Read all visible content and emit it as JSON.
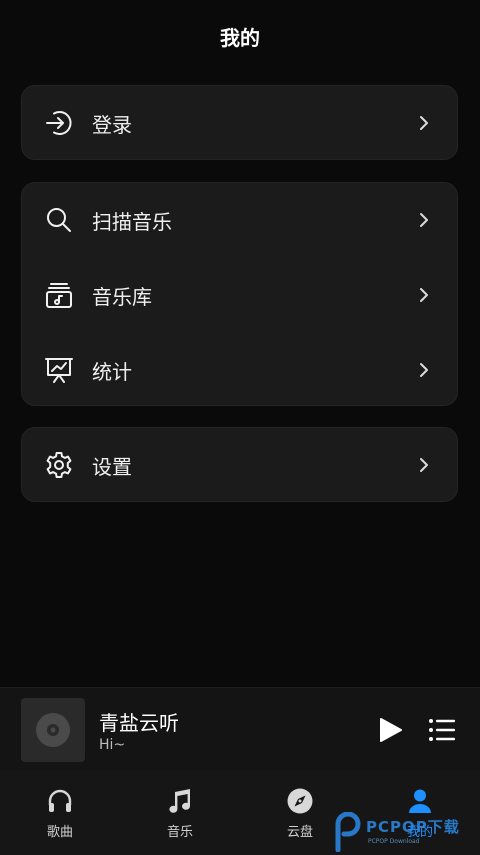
{
  "header": {
    "title": "我的"
  },
  "cards": {
    "login": {
      "label": "登录"
    },
    "library": {
      "scan": {
        "label": "扫描音乐"
      },
      "music_lib": {
        "label": "音乐库"
      },
      "stats": {
        "label": "统计"
      }
    },
    "settings": {
      "label": "设置"
    }
  },
  "player": {
    "title": "青盐云听",
    "subtitle": "Hi~"
  },
  "tabbar": {
    "tabs": [
      {
        "label": "歌曲"
      },
      {
        "label": "音乐"
      },
      {
        "label": "云盘"
      },
      {
        "label": "我的"
      }
    ],
    "active_color": "#1e8fff"
  },
  "watermark": {
    "text": "PCPOP下载",
    "sub": "PCPOP Download"
  }
}
